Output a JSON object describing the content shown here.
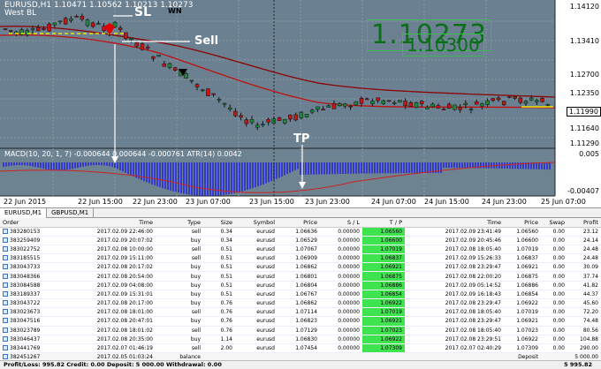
{
  "chart": {
    "symbol_header": "EURUSD,H1  1.10471 1.10562 1.10213 1.10273",
    "symbol_sub": "West BL",
    "indicator_header": "MACD(10, 20, 1, 7) -0.000644 0.000644 -0.000761  ATR(14) 0.0042",
    "big_price": "1.10273",
    "big_price_small": "1.10300",
    "price_labels": [
      "1.14120",
      "1.13410",
      "1.12700",
      "1.12350",
      "1.11990",
      "1.11640",
      "1.11290"
    ],
    "current_price": "1.11990",
    "indicator_labels": [
      "0.005",
      "-0.00407"
    ],
    "time_labels": [
      "22 Jun 2015",
      "22 Jun 15:00",
      "22 Jun 23:00",
      "23 Jun 07:00",
      "23 Jun 15:00",
      "23 Jun 23:00",
      "24 Jun 07:00",
      "24 Jun 15:00",
      "24 Jun 23:00",
      "25 Jun 07:00"
    ],
    "annotations": {
      "sl": "SL",
      "sell": "Sell",
      "tp": "TP",
      "wn": "WN"
    }
  },
  "tabs": [
    {
      "label": "EURUSD,M1",
      "active": true
    },
    {
      "label": "GBPUSD,M1",
      "active": false
    }
  ],
  "table": {
    "headers": [
      "Order",
      "Time",
      "Type",
      "Size",
      "Symbol",
      "Price",
      "S / L",
      "T / P",
      "Time",
      "Price",
      "Swap",
      "Profit"
    ],
    "rows": [
      [
        "383280153",
        "2017.02.09 22:46:00",
        "sell",
        "0.34",
        "eurusd",
        "1.06636",
        "0.00000",
        "1.06560",
        "2017.02.09 23:41:49",
        "1.06560",
        "0.00",
        "23.12"
      ],
      [
        "383259409",
        "2017.02.09 20:07:02",
        "buy",
        "0.34",
        "eurusd",
        "1.06529",
        "0.00000",
        "1.06600",
        "2017.02.09 20:45:46",
        "1.06600",
        "0.00",
        "24.14"
      ],
      [
        "383022752",
        "2017.02.08 10:00:00",
        "sell",
        "0.51",
        "eurusd",
        "1.07067",
        "0.00000",
        "1.07019",
        "2017.02.08 18:05:40",
        "1.07019",
        "0.00",
        "24.48"
      ],
      [
        "383185515",
        "2017.02.09 15:11:00",
        "sell",
        "0.51",
        "eurusd",
        "1.06909",
        "0.00000",
        "1.06837",
        "2017.02.09 15:26:33",
        "1.06837",
        "0.00",
        "24.48"
      ],
      [
        "383043733",
        "2017.02.08 20:17:02",
        "buy",
        "0.51",
        "eurusd",
        "1.06862",
        "0.00000",
        "1.06921",
        "2017.02.08 23:29:47",
        "1.06921",
        "0.00",
        "30.09"
      ],
      [
        "383048366",
        "2017.02.08 20:54:00",
        "buy",
        "0.51",
        "eurusd",
        "1.06801",
        "0.00000",
        "1.06875",
        "2017.02.08 22:00:20",
        "1.06875",
        "0.00",
        "37.74"
      ],
      [
        "383084588",
        "2017.02.09 04:08:00",
        "buy",
        "0.51",
        "eurusd",
        "1.06804",
        "0.00000",
        "1.06886",
        "2017.02.09 05:14:52",
        "1.06886",
        "0.00",
        "41.82"
      ],
      [
        "383189337",
        "2017.02.09 15:31:01",
        "buy",
        "0.51",
        "eurusd",
        "1.06767",
        "0.00000",
        "1.06854",
        "2017.02.09 16:18:43",
        "1.06854",
        "0.00",
        "44.37"
      ],
      [
        "383043722",
        "2017.02.08 20:17:00",
        "buy",
        "0.76",
        "eurusd",
        "1.06862",
        "0.00000",
        "1.06922",
        "2017.02.08 23:29:47",
        "1.06922",
        "0.00",
        "45.60"
      ],
      [
        "383023673",
        "2017.02.08 18:01:00",
        "sell",
        "0.76",
        "eurusd",
        "1.07114",
        "0.00000",
        "1.07019",
        "2017.02.08 18:05:40",
        "1.07019",
        "0.00",
        "72.20"
      ],
      [
        "383047516",
        "2017.02.08 20:47:01",
        "buy",
        "0.76",
        "eurusd",
        "1.06823",
        "0.00000",
        "1.06921",
        "2017.02.08 23:29:47",
        "1.06921",
        "0.00",
        "74.48"
      ],
      [
        "383023789",
        "2017.02.08 18:01:02",
        "sell",
        "0.76",
        "eurusd",
        "1.07129",
        "0.00000",
        "1.07023",
        "2017.02.08 18:05:40",
        "1.07023",
        "0.00",
        "80.56"
      ],
      [
        "383046437",
        "2017.02.08 20:35:00",
        "buy",
        "1.14",
        "eurusd",
        "1.06830",
        "0.00000",
        "1.06922",
        "2017.02.08 23:29:51",
        "1.06922",
        "0.00",
        "104.88"
      ],
      [
        "383441769",
        "2017.02.07 01:46:19",
        "sell",
        "2.00",
        "eurusd",
        "1.07454",
        "0.00000",
        "1.07309",
        "2017.02.07 02:40:29",
        "1.07309",
        "0.00",
        "290.00"
      ]
    ],
    "balance_row": {
      "order": "382451267",
      "time": "2017.02.05 01:03:24",
      "type": "balance",
      "label": "Deposit",
      "amount": "5 000.00"
    }
  },
  "status": {
    "summary": "Profit/Loss: 995.82  Credit: 0.00  Deposit: 5 000.00  Withdrawal: 0.00",
    "total": "5 995.82"
  }
}
